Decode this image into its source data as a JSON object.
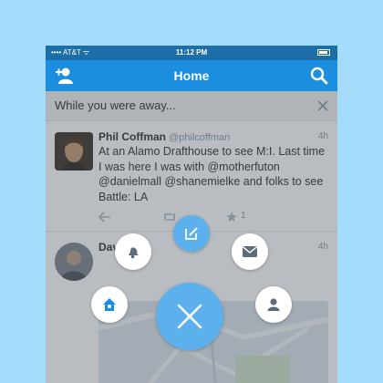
{
  "status_bar": {
    "carrier": "•••• AT&T ᯤ",
    "time": "11:12 PM"
  },
  "nav": {
    "title": "Home",
    "left_icon": "add-user-icon",
    "right_icon": "search-icon"
  },
  "while_away": {
    "label": "While you were away...",
    "close_icon": "close-icon"
  },
  "tweets": [
    {
      "name": "Phil Coffman",
      "handle": "@philcoffman",
      "time": "4h",
      "text": "At an Alamo Drafthouse to see M:I. Last time I was here I was with @motherfuton @danielmall @shanemielke and folks to see Battle: LA",
      "fav_count": "1"
    },
    {
      "name": "Dav",
      "handle": "",
      "time": "4h"
    }
  ],
  "fab_menu": {
    "main_icon": "close-icon",
    "items": [
      "compose-icon",
      "notifications-icon",
      "messages-icon",
      "home-icon",
      "profile-icon"
    ]
  },
  "colors": {
    "background": "#a6dcfb",
    "twitter_blue": "#1b8ee0",
    "fab_blue": "#5cb1ed"
  }
}
